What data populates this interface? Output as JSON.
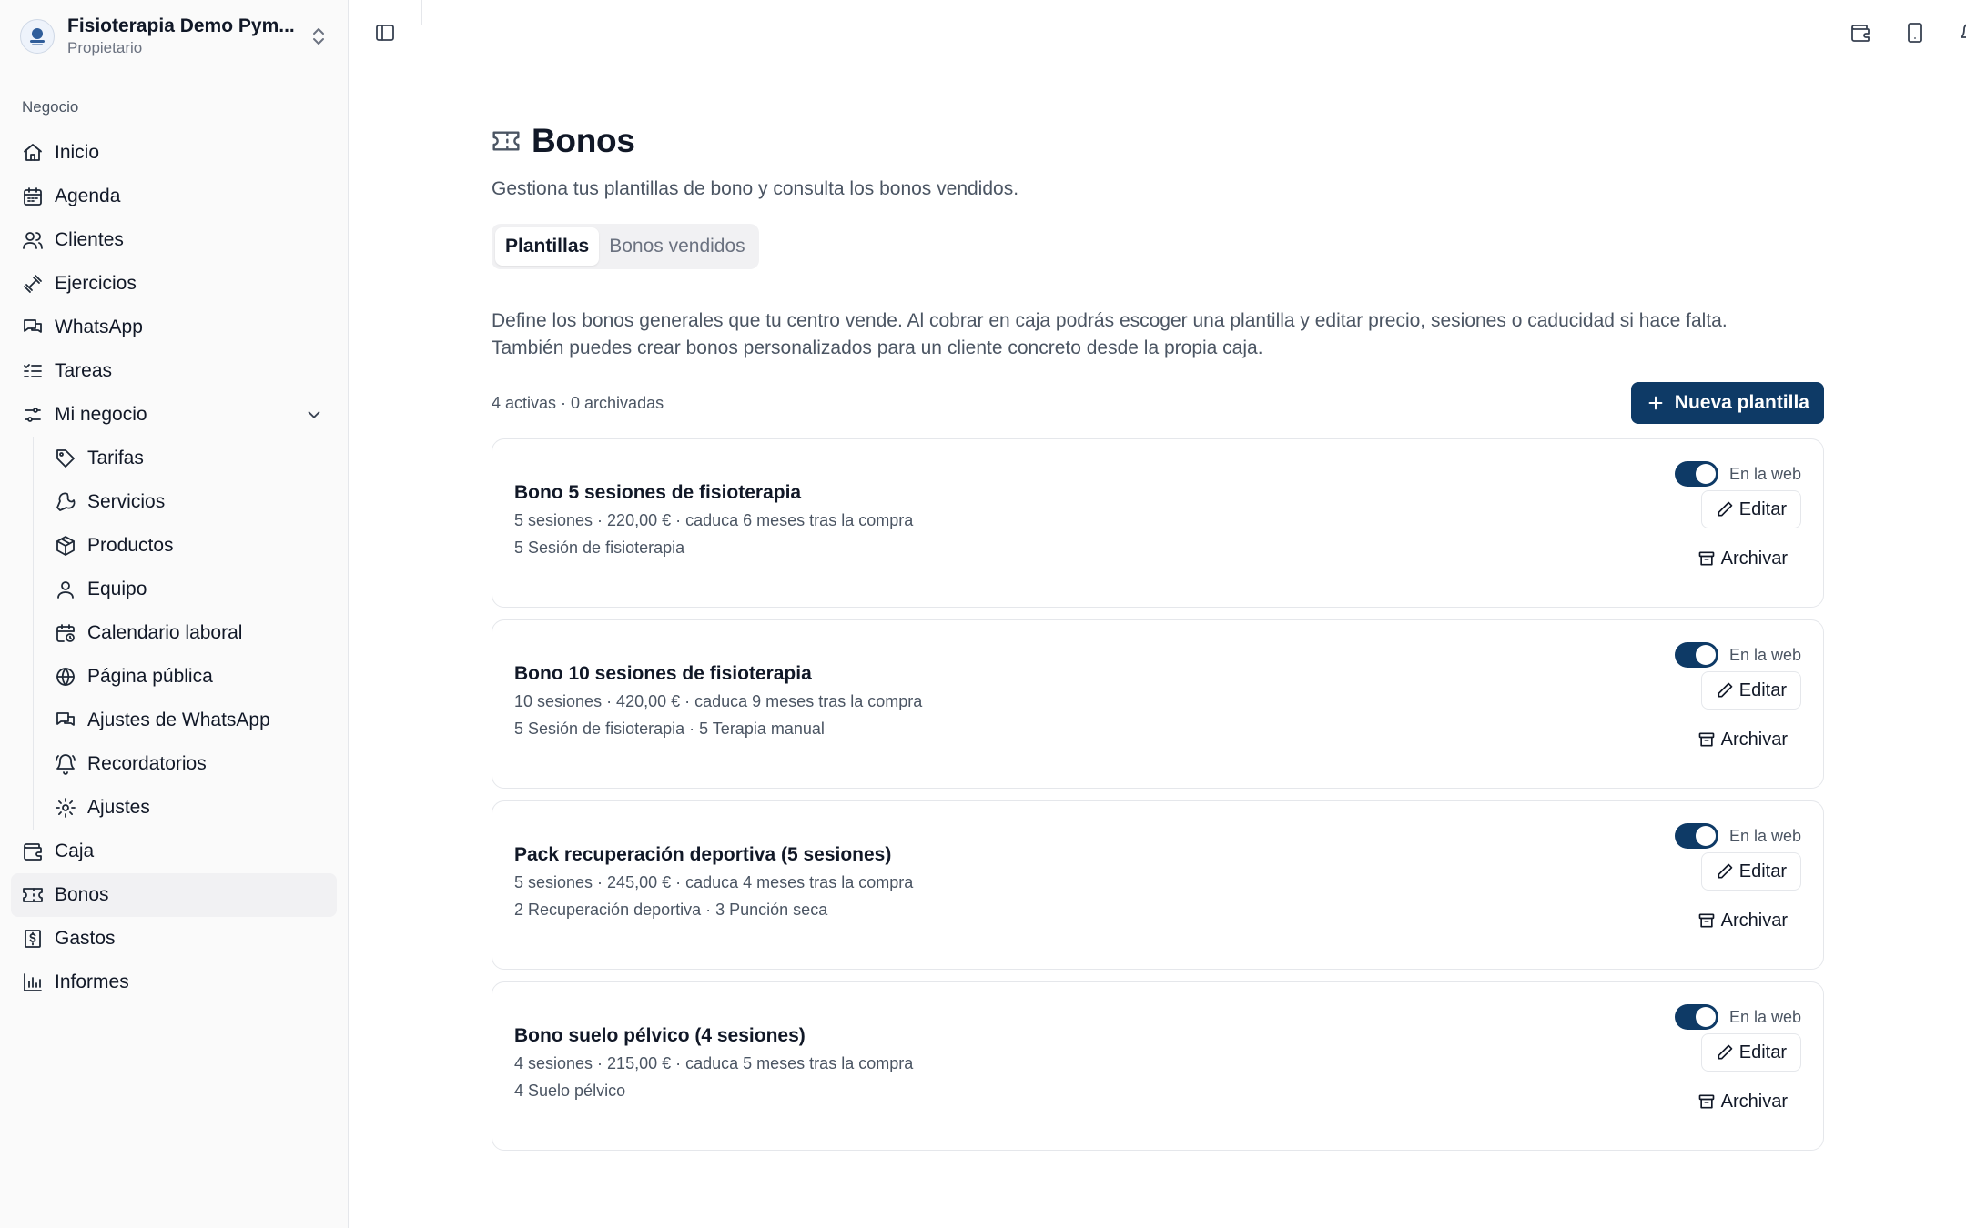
{
  "sidebar": {
    "org_name": "Fisioterapia Demo Pym...",
    "org_role": "Propietario",
    "group_label": "Negocio",
    "items": {
      "inicio": "Inicio",
      "agenda": "Agenda",
      "clientes": "Clientes",
      "ejercicios": "Ejercicios",
      "whatsapp": "WhatsApp",
      "tareas": "Tareas",
      "mi_negocio": "Mi negocio",
      "caja": "Caja",
      "bonos": "Bonos",
      "gastos": "Gastos",
      "informes": "Informes"
    },
    "sub_items": {
      "tarifas": "Tarifas",
      "servicios": "Servicios",
      "productos": "Productos",
      "equipo": "Equipo",
      "calendario": "Calendario laboral",
      "pagina_publica": "Página pública",
      "ajustes_whatsapp": "Ajustes de WhatsApp",
      "recordatorios": "Recordatorios",
      "ajustes": "Ajustes"
    },
    "active_item": "Bonos"
  },
  "header": {
    "icons": [
      "sidebar-toggle-icon",
      "wallet-icon",
      "tablet-icon",
      "bell-icon"
    ]
  },
  "page": {
    "title": "Bonos",
    "subtitle": "Gestiona tus plantillas de bono y consulta los bonos vendidos.",
    "tabs": {
      "templates": "Plantillas",
      "sold": "Bonos vendidos"
    },
    "active_tab": "Plantillas",
    "description_1": "Define los bonos generales que tu centro vende. Al cobrar en caja podrás escoger una plantilla y editar precio, sesiones o caducidad si hace falta.",
    "description_2": "También puedes crear bonos personalizados para un cliente concreto desde la propia caja.",
    "counts": "4 activas · 0 archivadas",
    "new_button": "Nueva plantilla"
  },
  "templates": [
    {
      "name": "Bono 5 sesiones de fisioterapia",
      "details": "5 sesiones · 220,00 € · caduca 6 meses tras la compra",
      "services": "5 Sesión de fisioterapia",
      "web_label": "En la web",
      "web_enabled": true,
      "edit_label": "Editar",
      "archive_label": "Archivar"
    },
    {
      "name": "Bono 10 sesiones de fisioterapia",
      "details": "10 sesiones · 420,00 € · caduca 9 meses tras la compra",
      "services": "5 Sesión de fisioterapia · 5 Terapia manual",
      "web_label": "En la web",
      "web_enabled": true,
      "edit_label": "Editar",
      "archive_label": "Archivar"
    },
    {
      "name": "Pack recuperación deportiva (5 sesiones)",
      "details": "5 sesiones · 245,00 € · caduca 4 meses tras la compra",
      "services": "2 Recuperación deportiva · 3 Punción seca",
      "web_label": "En la web",
      "web_enabled": true,
      "edit_label": "Editar",
      "archive_label": "Archivar"
    },
    {
      "name": "Bono suelo pélvico (4 sesiones)",
      "details": "4 sesiones · 215,00 € · caduca 5 meses tras la compra",
      "services": "4 Suelo pélvico",
      "web_label": "En la web",
      "web_enabled": true,
      "edit_label": "Editar",
      "archive_label": "Archivar"
    }
  ],
  "colors": {
    "primary": "#0e3a66",
    "sidebar_bg": "#fafafa",
    "border": "#e5e7eb",
    "muted_text": "#4b5563"
  }
}
